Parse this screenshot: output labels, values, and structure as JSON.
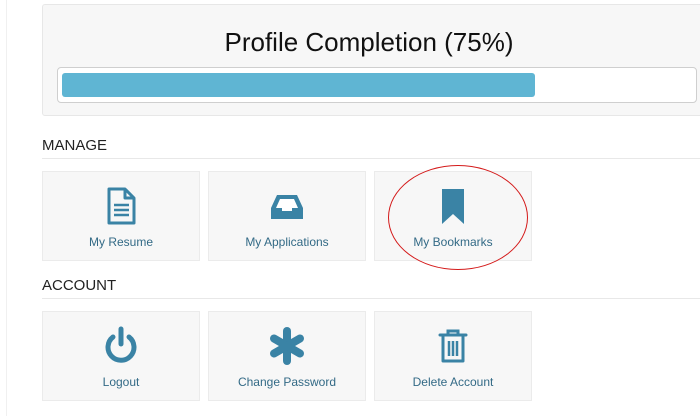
{
  "profile_completion": {
    "title": "Profile Completion (75%)",
    "progress_fraction": 0.75
  },
  "manage": {
    "heading": "MANAGE",
    "tiles": [
      {
        "label": "My Resume",
        "icon": "document-icon"
      },
      {
        "label": "My Applications",
        "icon": "inbox-tray-icon"
      },
      {
        "label": "My Bookmarks",
        "icon": "bookmark-icon"
      }
    ]
  },
  "account": {
    "heading": "ACCOUNT",
    "tiles": [
      {
        "label": "Logout",
        "icon": "power-icon"
      },
      {
        "label": "Change Password",
        "icon": "asterisk-icon"
      },
      {
        "label": "Delete Account",
        "icon": "trash-icon"
      }
    ]
  },
  "colors": {
    "accent": "#3a83a5",
    "progress": "#5fb5d3",
    "annotation": "#d41a1a"
  }
}
